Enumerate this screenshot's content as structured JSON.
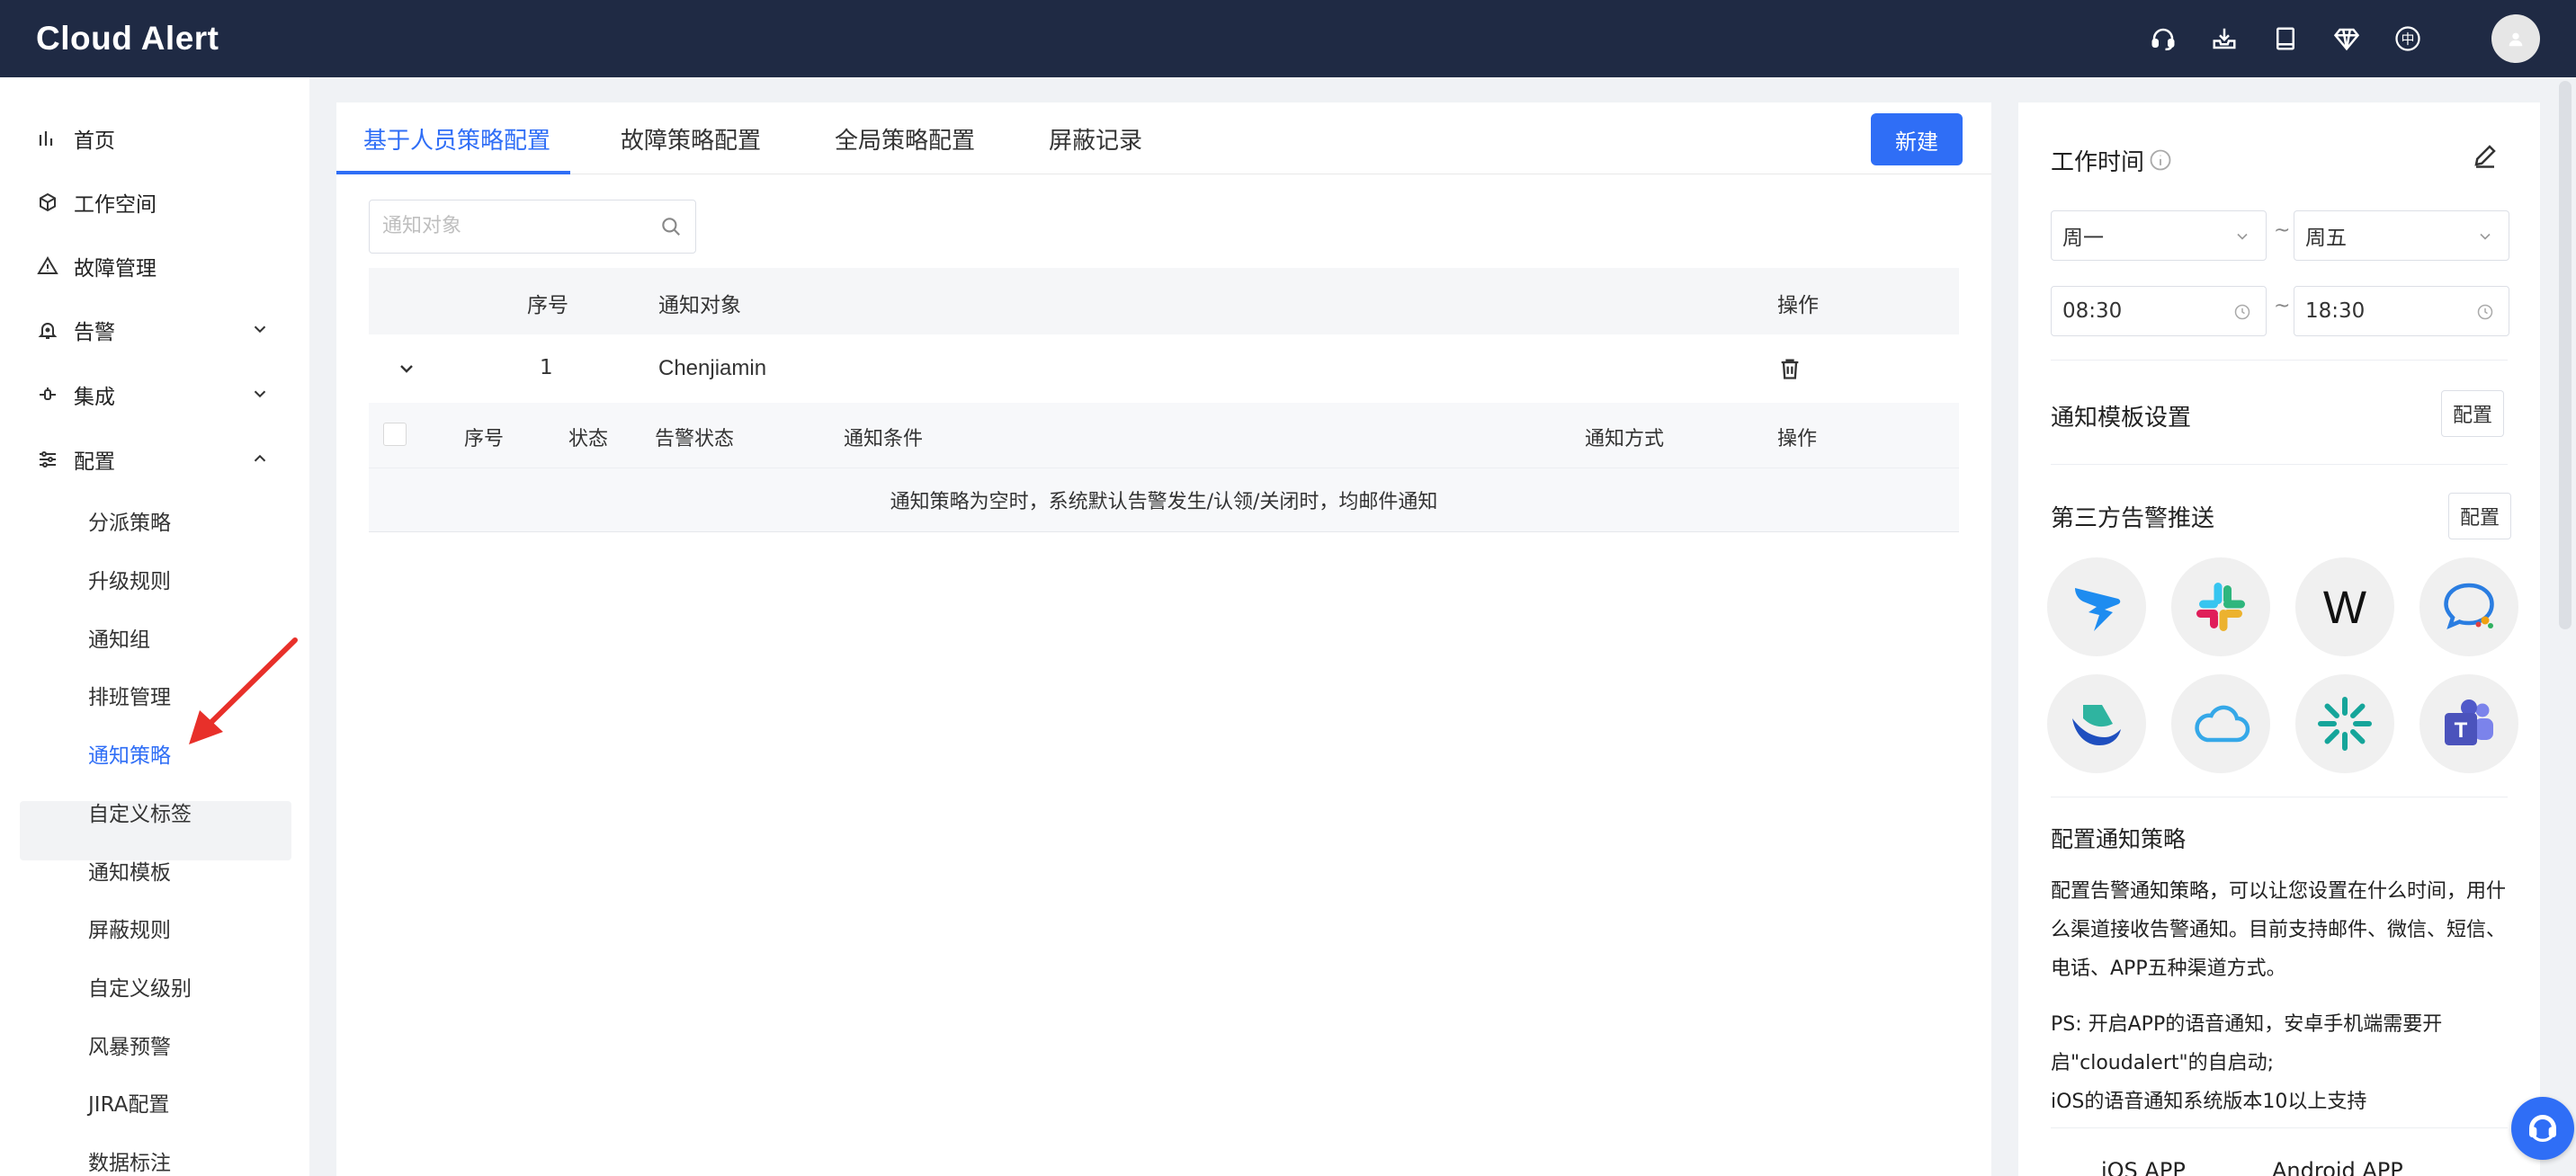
{
  "app": {
    "title": "Cloud Alert"
  },
  "header_icons": [
    "headset-icon",
    "download-icon",
    "book-icon",
    "diamond-icon",
    "language-icon",
    "user-avatar"
  ],
  "header": {
    "lang_char": "中"
  },
  "sidebar": {
    "items": [
      {
        "label": "首页",
        "icon": "chart-bars-icon"
      },
      {
        "label": "工作空间",
        "icon": "cube-icon"
      },
      {
        "label": "故障管理",
        "icon": "warning-icon"
      },
      {
        "label": "告警",
        "icon": "bell-icon",
        "expandable": true
      },
      {
        "label": "集成",
        "icon": "plug-icon",
        "expandable": true
      },
      {
        "label": "配置",
        "icon": "sliders-icon",
        "expandable": true,
        "expanded": true
      }
    ],
    "subitems": [
      {
        "label": "分派策略"
      },
      {
        "label": "升级规则"
      },
      {
        "label": "通知组"
      },
      {
        "label": "排班管理"
      },
      {
        "label": "通知策略",
        "active": true
      },
      {
        "label": "自定义标签"
      },
      {
        "label": "通知模板"
      },
      {
        "label": "屏蔽规则"
      },
      {
        "label": "自定义级别"
      },
      {
        "label": "风暴预警"
      },
      {
        "label": "JIRA配置"
      },
      {
        "label": "数据标注"
      }
    ]
  },
  "main": {
    "tabs": [
      {
        "label": "基于人员策略配置",
        "active": true
      },
      {
        "label": "故障策略配置"
      },
      {
        "label": "全局策略配置"
      },
      {
        "label": "屏蔽记录"
      }
    ],
    "new_button": "新建",
    "search": {
      "placeholder": "通知对象",
      "value": ""
    },
    "table": {
      "headers": {
        "index": "序号",
        "target": "通知对象",
        "action": "操作"
      },
      "rows": [
        {
          "index": "1",
          "target": "Chenjiamin"
        }
      ],
      "sub_headers": {
        "index": "序号",
        "status": "状态",
        "alert_status": "告警状态",
        "condition": "通知条件",
        "method": "通知方式",
        "action": "操作"
      },
      "empty_text": "通知策略为空时，系统默认告警发生/认领/关闭时，均邮件通知"
    }
  },
  "right": {
    "work_time": {
      "title": "工作时间",
      "day_from": "周一",
      "day_to": "周五",
      "time_from": "08:30",
      "time_to": "18:30",
      "separator": "~"
    },
    "template": {
      "title": "通知模板设置",
      "button": "配置"
    },
    "third_party": {
      "title": "第三方告警推送",
      "button": "配置",
      "integrations": [
        "dingtalk-icon",
        "slack-icon",
        "wecom-w-icon",
        "chat-bubble-icon",
        "feishu-icon",
        "cloud-icon",
        "starburst-icon",
        "teams-icon"
      ],
      "wecom_letter": "W",
      "teams_letter": "T"
    },
    "policy_help": {
      "title": "配置通知策略",
      "lines": [
        "配置告警通知策略，可以让您设置在什么时间，用什",
        "么渠道接收告警通知。目前支持邮件、微信、短信、",
        "电话、APP五种渠道方式。"
      ],
      "ps_lines": [
        "PS: 开启APP的语音通知，安卓手机端需要开",
        "启\"cloudalert\"的自启动;",
        "iOS的语音通知系统版本10以上支持"
      ]
    },
    "apps": {
      "ios": "iOS APP",
      "android": "Android APP"
    }
  },
  "colors": {
    "topbar": "#1f2a44",
    "primary": "#2f6ef6",
    "annotation_arrow": "#e8302a"
  }
}
